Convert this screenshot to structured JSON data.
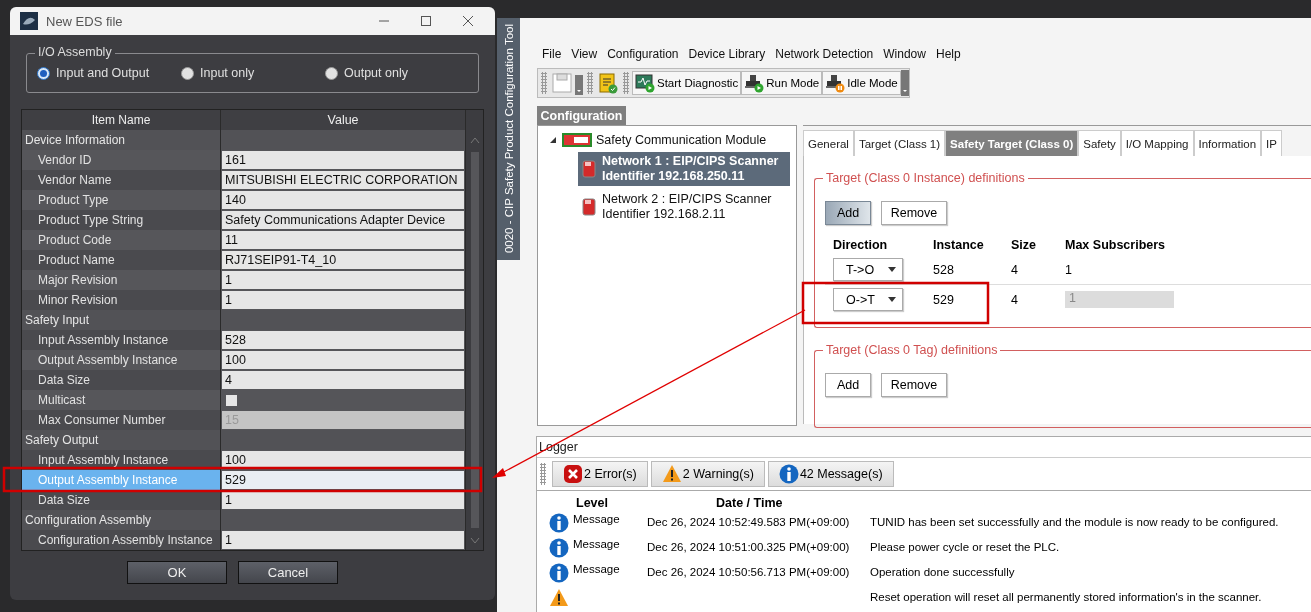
{
  "dialog": {
    "title": "New EDS file",
    "io_assembly": {
      "label": "I/O Assembly",
      "options": [
        {
          "label": "Input and Output",
          "selected": true
        },
        {
          "label": "Input only",
          "selected": false
        },
        {
          "label": "Output only",
          "selected": false
        }
      ]
    },
    "grid": {
      "columns": [
        "Item Name",
        "Value"
      ],
      "categories": [
        {
          "name": "Device Information",
          "items": [
            {
              "kind": "text",
              "name": "Vendor ID",
              "value": "161",
              "selected": false
            },
            {
              "kind": "text",
              "name": "Vendor Name",
              "value": "MITSUBISHI ELECTRIC CORPORATION",
              "selected": false
            },
            {
              "kind": "text",
              "name": "Product Type",
              "value": "140",
              "selected": false
            },
            {
              "kind": "text",
              "name": "Product Type String",
              "value": "Safety Communications Adapter Device",
              "selected": false
            },
            {
              "kind": "text",
              "name": "Product Code",
              "value": "11",
              "selected": false
            },
            {
              "kind": "text",
              "name": "Product Name",
              "value": "RJ71SEIP91-T4_10",
              "selected": false
            },
            {
              "kind": "text",
              "name": "Major Revision",
              "value": "1",
              "selected": false
            },
            {
              "kind": "text",
              "name": "Minor Revision",
              "value": "1",
              "selected": false
            }
          ]
        },
        {
          "name": "Safety Input",
          "items": [
            {
              "kind": "text",
              "name": "Input Assembly Instance",
              "value": "528",
              "selected": false
            },
            {
              "kind": "text",
              "name": "Output Assembly Instance",
              "value": "100",
              "selected": false
            },
            {
              "kind": "text",
              "name": "Data Size",
              "value": "4",
              "selected": false
            },
            {
              "kind": "checkbox",
              "name": "Multicast",
              "checked": false,
              "selected": false
            },
            {
              "kind": "readonly",
              "name": "Max Consumer Number",
              "value": "15",
              "selected": false
            }
          ]
        },
        {
          "name": "Safety Output",
          "items": [
            {
              "kind": "text",
              "name": "Input Assembly Instance",
              "value": "100",
              "selected": false
            },
            {
              "kind": "text",
              "name": "Output Assembly Instance",
              "value": "529",
              "selected": true
            },
            {
              "kind": "text",
              "name": "Data Size",
              "value": "1",
              "selected": false
            }
          ]
        },
        {
          "name": "Configuration Assembly",
          "items": [
            {
              "kind": "text",
              "name": "Configuration Assembly Instance",
              "value": "1",
              "selected": false
            }
          ]
        }
      ]
    },
    "buttons": [
      "OK",
      "Cancel"
    ]
  },
  "app": {
    "title": "0020 - CIP Safety Product Configuration Tool",
    "menu": [
      "File",
      "View",
      "Configuration",
      "Device Library",
      "Network Detection",
      "Window",
      "Help"
    ],
    "toolbar": [
      "Start Diagnostic",
      "Run Mode",
      "Idle Mode"
    ],
    "panel_tab": "Configuration",
    "tree": {
      "label": "Safety Communication Module",
      "expanded": true,
      "children": [
        {
          "lines": [
            "Network 1 : EIP/CIPS Scanner",
            "Identifier 192.168.250.11"
          ],
          "selected": true
        },
        {
          "lines": [
            "Network 2 : EIP/CIPS Scanner",
            "Identifier 192.168.2.11"
          ],
          "selected": false
        }
      ]
    },
    "tabs": [
      {
        "label": "General",
        "selected": false
      },
      {
        "label": "Target (Class 1)",
        "selected": false
      },
      {
        "label": "Safety Target (Class 0)",
        "selected": true
      },
      {
        "label": "Safety",
        "selected": false
      },
      {
        "label": "I/O Mapping",
        "selected": false
      },
      {
        "label": "Information",
        "selected": false
      },
      {
        "label": "IP",
        "selected": false
      }
    ],
    "instance_group": {
      "title": "Target (Class 0 Instance) definitions",
      "buttons": [
        {
          "label": "Add",
          "pressed": true
        },
        {
          "label": "Remove",
          "pressed": false
        }
      ],
      "columns": [
        "Direction",
        "Instance",
        "Size",
        "Max Subscribers"
      ],
      "rows": [
        {
          "direction": "T->O",
          "instance": "528",
          "size": "4",
          "max_subscribers": "1",
          "disabled": false
        },
        {
          "direction": "O->T",
          "instance": "529",
          "size": "4",
          "max_subscribers": "1",
          "disabled": true
        }
      ]
    },
    "tag_group": {
      "title": "Target (Class 0 Tag) definitions",
      "buttons": [
        {
          "label": "Add",
          "pressed": false
        },
        {
          "label": "Remove",
          "pressed": false
        }
      ]
    },
    "logger": {
      "title": "Logger",
      "filters": [
        {
          "kind": "error",
          "label": "2 Error(s)"
        },
        {
          "kind": "warning",
          "label": "2 Warning(s)"
        },
        {
          "kind": "info",
          "label": "42 Message(s)"
        }
      ],
      "columns": [
        "Level",
        "Date / Time"
      ],
      "rows": [
        {
          "kind": "info",
          "level": "Message",
          "time": "Dec 26, 2024 10:52:49.583 PM(+09:00)",
          "message": "TUNID has been set successfully and the module is now ready to be configured."
        },
        {
          "kind": "info",
          "level": "Message",
          "time": "Dec 26, 2024 10:51:00.325 PM(+09:00)",
          "message": "Please power cycle or reset the PLC."
        },
        {
          "kind": "info",
          "level": "Message",
          "time": "Dec 26, 2024 10:50:56.713 PM(+09:00)",
          "message": "Operation done successfully"
        },
        {
          "kind": "warning",
          "message": "Reset operation will reset all permanently stored information's in the scanner."
        }
      ]
    }
  }
}
